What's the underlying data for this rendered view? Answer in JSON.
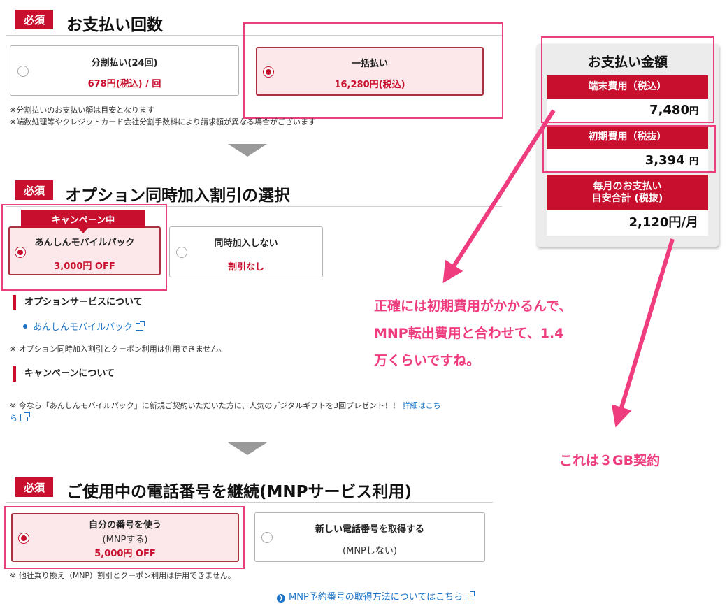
{
  "required_label": "必須",
  "payment_section": {
    "title": "お支払い回数",
    "options": [
      {
        "title": "分割払い(24回)",
        "price": "678円(税込) / 回",
        "selected": false
      },
      {
        "title": "一括払い",
        "price": "16,280円(税込)",
        "selected": true
      }
    ],
    "notes": [
      "※分割払いのお支払い額は目安となります",
      "※端数処理等やクレジットカード会社分割手数料により請求額が異なる場合がございます"
    ]
  },
  "option_section": {
    "title": "オプション同時加入割引の選択",
    "campaign_tag": "キャンペーン中",
    "options": [
      {
        "title": "あんしんモバイルパック",
        "price": "3,000円 OFF",
        "selected": true
      },
      {
        "title": "同時加入しない",
        "price": "割引なし",
        "selected": false
      }
    ],
    "about_option_heading": "オプションサービスについて",
    "option_link": "あんしんモバイルパック",
    "option_note": "※ オプション同時加入割引とクーポン利用は併用できません。",
    "campaign_heading": "キャンペーンについて",
    "campaign_note_line1": "※ 今なら「あんしんモバイルパック」に新規ご契約いただいた方に、人気のデジタルギフトを3回プレゼント！！",
    "campaign_detail_link_part1": "詳細はこち",
    "campaign_detail_link_part2": "ら"
  },
  "mnp_section": {
    "title": "ご使用中の電話番号を継続(MNPサービス利用)",
    "options": [
      {
        "title": "自分の番号を使う",
        "sub": "(MNPする)",
        "price": "5,000円 OFF",
        "selected": true
      },
      {
        "title": "新しい電話番号を取得する",
        "sub": "(MNPしない)",
        "selected": false
      }
    ],
    "note": "※ 他社乗り換え（MNP）割引とクーポン利用は併用できません。",
    "howto_link": "MNP予約番号の取得方法についてはこちら"
  },
  "summary": {
    "title": "お支払い金額",
    "device_label": "端末費用（税込）",
    "device_value": "7,480",
    "initial_label": "初期費用（税抜）",
    "initial_value": "3,394",
    "monthly_label_line1": "毎月のお支払い",
    "monthly_label_line2": "目安合計 (税抜)",
    "monthly_value": "2,120円/月",
    "yen": "円"
  },
  "annotations": {
    "initial_cost_line1": "正確には初期費用がかかるんで、",
    "initial_cost_line2": "MNP転出費用と合わせて、1.4",
    "initial_cost_line3": "万くらいですね。",
    "plan_note": "これは３GB契約"
  },
  "colors": {
    "brand_red": "#c8102e",
    "annotation_pink": "#ee3c7f",
    "link_blue": "#1a73c8"
  }
}
